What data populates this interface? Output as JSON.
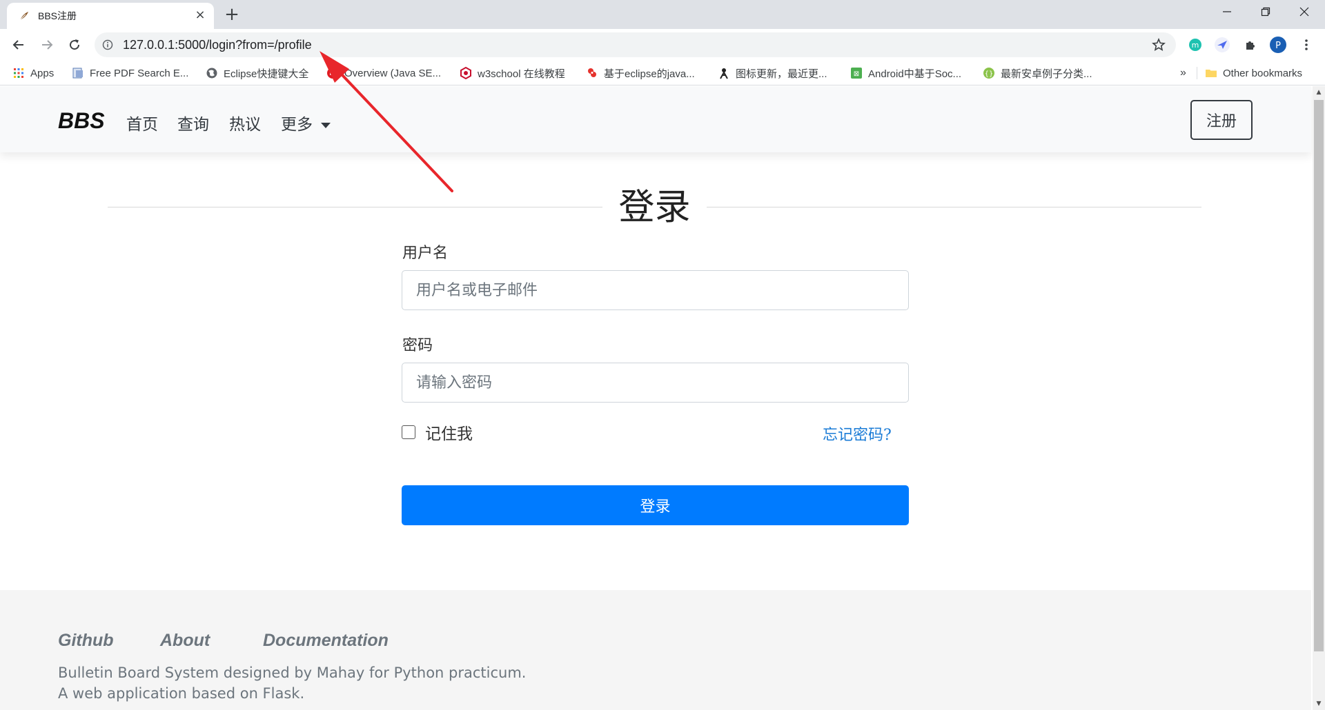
{
  "browser": {
    "tab_title": "BBS注册",
    "close_glyph": "×",
    "newtab_glyph": "+",
    "url": "127.0.0.1:5000/login?from=/profile",
    "profile_initial": "P",
    "bookmarks": [
      {
        "label": "Apps",
        "icon": "apps-grid-icon"
      },
      {
        "label": "Free PDF Search E...",
        "icon": "pdf-icon"
      },
      {
        "label": "Eclipse快捷键大全",
        "icon": "globe-icon"
      },
      {
        "label": "Overview (Java SE...",
        "icon": "java-icon"
      },
      {
        "label": "w3school 在线教程",
        "icon": "w3school-icon"
      },
      {
        "label": "基于eclipse的java...",
        "icon": "csdn-icon"
      },
      {
        "label": "图标更新，最近更...",
        "icon": "android-icon"
      },
      {
        "label": "Android中基于Soc...",
        "icon": "site-icon"
      },
      {
        "label": "最新安卓例子分类...",
        "icon": "site-icon"
      }
    ],
    "more_bookmarks": "»",
    "other_bookmarks": "Other bookmarks"
  },
  "navbar": {
    "brand": "BBS",
    "links": [
      "首页",
      "查询",
      "热议",
      "更多"
    ],
    "register": "注册"
  },
  "login": {
    "title": "登录",
    "username_label": "用户名",
    "username_placeholder": "用户名或电子邮件",
    "password_label": "密码",
    "password_placeholder": "请输入密码",
    "remember": "记住我",
    "forgot": "忘记密码?",
    "submit": "登录"
  },
  "footer": {
    "links": [
      "Github",
      "About",
      "Documentation"
    ],
    "desc1": "Bulletin Board System designed by Mahay for Python practicum.",
    "desc2": "A web application based on Flask."
  },
  "colors": {
    "primary": "#007bff",
    "annotation_arrow": "#e8262b"
  }
}
